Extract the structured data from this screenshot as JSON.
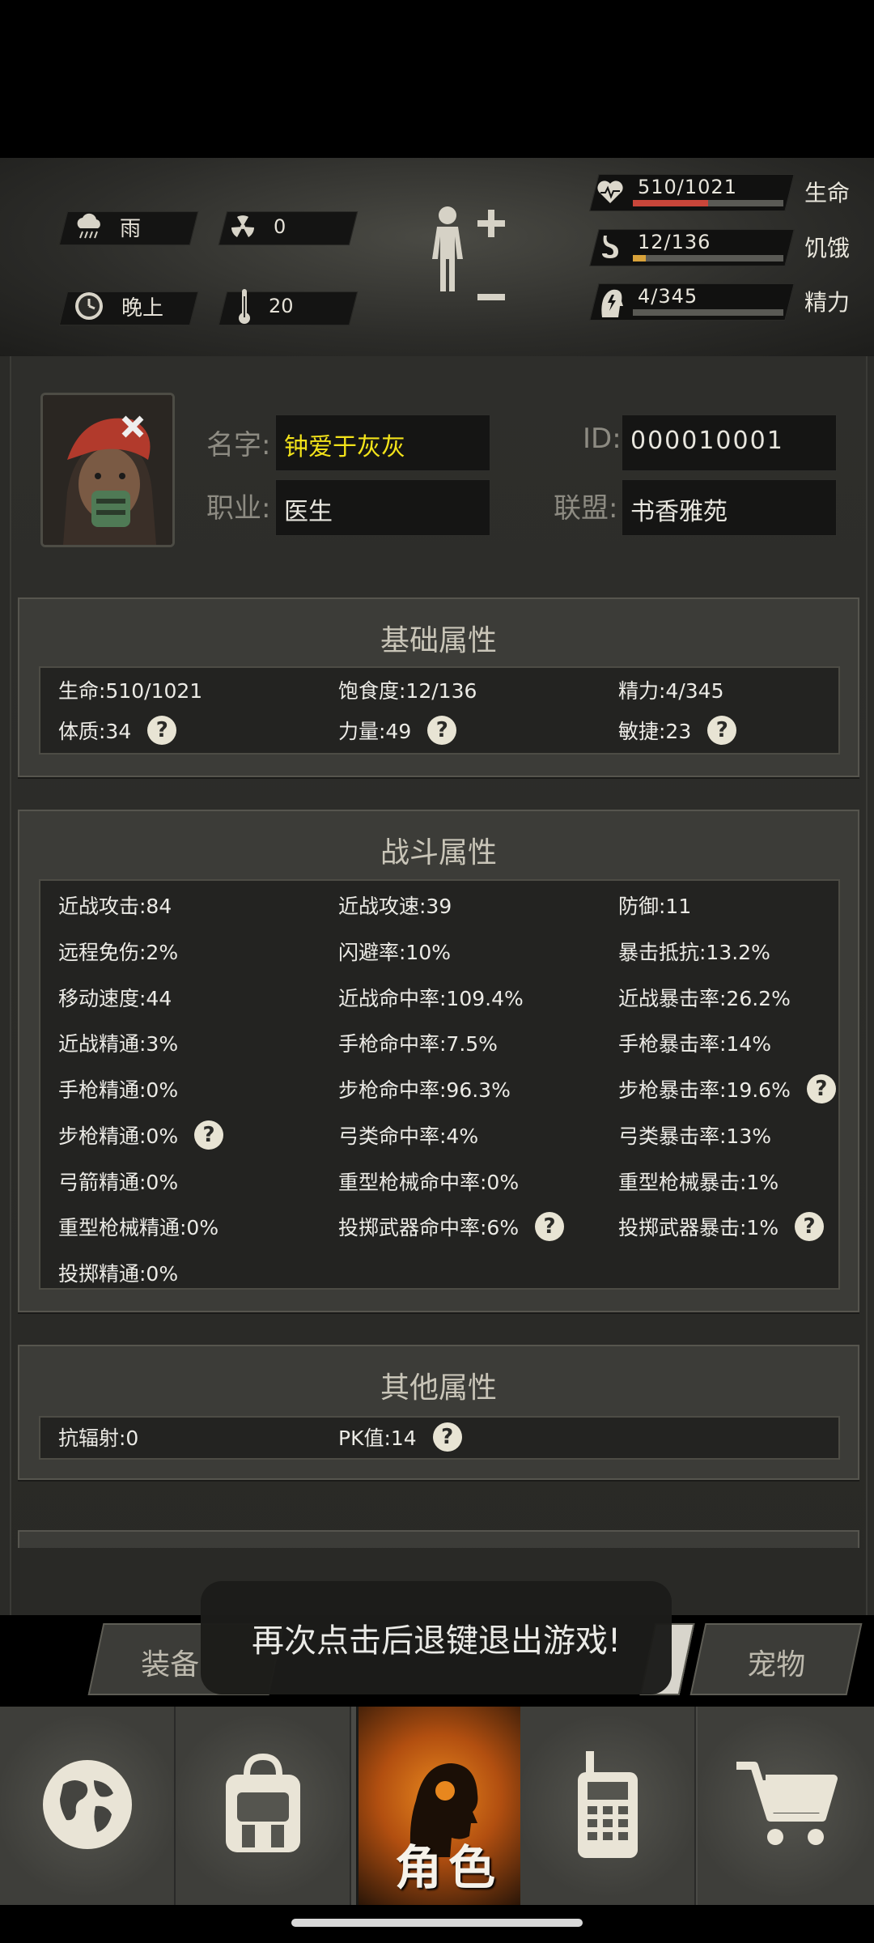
{
  "hud": {
    "weather": "雨",
    "radiation": "0",
    "time_of_day": "晚上",
    "temperature": "20",
    "bars": [
      {
        "name": "生命",
        "value_text": "510/1021",
        "fraction": 0.4995,
        "color": "#c9463a",
        "icon": "heart-pulse-icon"
      },
      {
        "name": "饥饿",
        "value_text": "12/136",
        "fraction": 0.0882,
        "color": "#d8a23a",
        "icon": "stomach-icon"
      },
      {
        "name": "精力",
        "value_text": "4/345",
        "fraction": 0.0116,
        "color": "#7a7a74",
        "icon": "energy-head-icon"
      }
    ],
    "icons": {
      "weather": "rain-cloud-icon",
      "radiation": "radiation-icon",
      "time": "clock-icon",
      "temperature": "thermometer-icon",
      "body": "body-plus-minus-icon"
    }
  },
  "profile": {
    "name_label": "名字:",
    "name_value": "钟爱于灰灰",
    "name_color": "#f2e21a",
    "id_label": "ID:",
    "id_value": "000010001",
    "job_label": "职业:",
    "job_value": "医生",
    "alliance_label": "联盟:",
    "alliance_value": "书香雅苑"
  },
  "sections": {
    "basic": {
      "title": "基础属性",
      "rows": [
        [
          "生命:510/1021",
          "饱食度:12/136",
          "精力:4/345"
        ],
        [
          "体质:34",
          "力量:49",
          "敏捷:23"
        ]
      ]
    },
    "combat": {
      "title": "战斗属性",
      "rows": [
        [
          "近战攻击:84",
          "近战攻速:39",
          "防御:11"
        ],
        [
          "远程免伤:2%",
          "闪避率:10%",
          "暴击抵抗:13.2%"
        ],
        [
          "移动速度:44",
          "近战命中率:109.4%",
          "近战暴击率:26.2%"
        ],
        [
          "近战精通:3%",
          "手枪命中率:7.5%",
          "手枪暴击率:14%"
        ],
        [
          "手枪精通:0%",
          "步枪命中率:96.3%",
          "步枪暴击率:19.6%"
        ],
        [
          "步枪精通:0%",
          "弓类命中率:4%",
          "弓类暴击率:13%"
        ],
        [
          "弓箭精通:0%",
          "重型枪械命中率:0%",
          "重型枪械暴击:1%"
        ],
        [
          "重型枪械精通:0%",
          "投掷武器命中率:6%",
          "投掷武器暴击:1%"
        ],
        [
          "投掷精通:0%",
          "",
          ""
        ]
      ]
    },
    "other": {
      "title": "其他属性",
      "rows": [
        [
          "抗辐射:0",
          "PK值:14",
          ""
        ]
      ]
    }
  },
  "tabs": {
    "left": "装备",
    "right": "宠物"
  },
  "toast": "再次点击后退键退出游戏!",
  "nav": {
    "active_label": "角色",
    "items": [
      "globe-icon",
      "backpack-icon",
      "character-head-icon",
      "walkie-talkie-icon",
      "shopping-cart-icon"
    ]
  },
  "help_symbol": "?"
}
